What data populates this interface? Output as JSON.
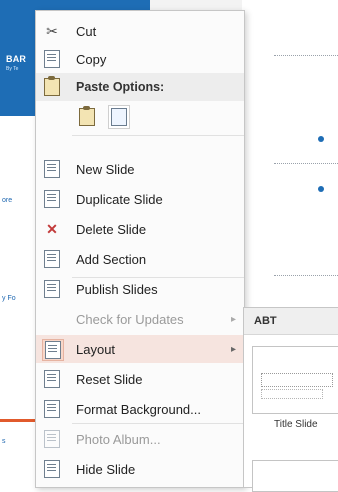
{
  "background": {
    "thumbnail_title": "BAR",
    "thumbnail_subtitle": "By Te",
    "left_snippets": [
      "ore",
      "y Fo",
      "s"
    ]
  },
  "context_menu": {
    "items": [
      {
        "label": "Cut",
        "icon": "scissors-icon"
      },
      {
        "label": "Copy",
        "icon": "copy-icon"
      },
      {
        "label": "Paste Options:",
        "icon": "paste-icon"
      },
      {
        "label": "New Slide",
        "icon": "new-slide-icon"
      },
      {
        "label": "Duplicate Slide",
        "icon": "duplicate-slide-icon"
      },
      {
        "label": "Delete Slide",
        "icon": "delete-slide-icon"
      },
      {
        "label": "Add Section",
        "icon": "add-section-icon"
      },
      {
        "label": "Publish Slides",
        "icon": "publish-slides-icon"
      },
      {
        "label": "Check for Updates",
        "icon": "none"
      },
      {
        "label": "Layout",
        "icon": "layout-icon"
      },
      {
        "label": "Reset Slide",
        "icon": "reset-slide-icon"
      },
      {
        "label": "Format Background...",
        "icon": "format-background-icon"
      },
      {
        "label": "Photo Album...",
        "icon": "photo-album-icon"
      },
      {
        "label": "Hide Slide",
        "icon": "hide-slide-icon"
      }
    ],
    "submenu_arrow": "▸"
  },
  "layout_submenu": {
    "header": "ABT",
    "first_layout_label": "Title Slide"
  },
  "colors": {
    "accent_blue": "#1e6db5",
    "highlight": "#f6e4df"
  }
}
